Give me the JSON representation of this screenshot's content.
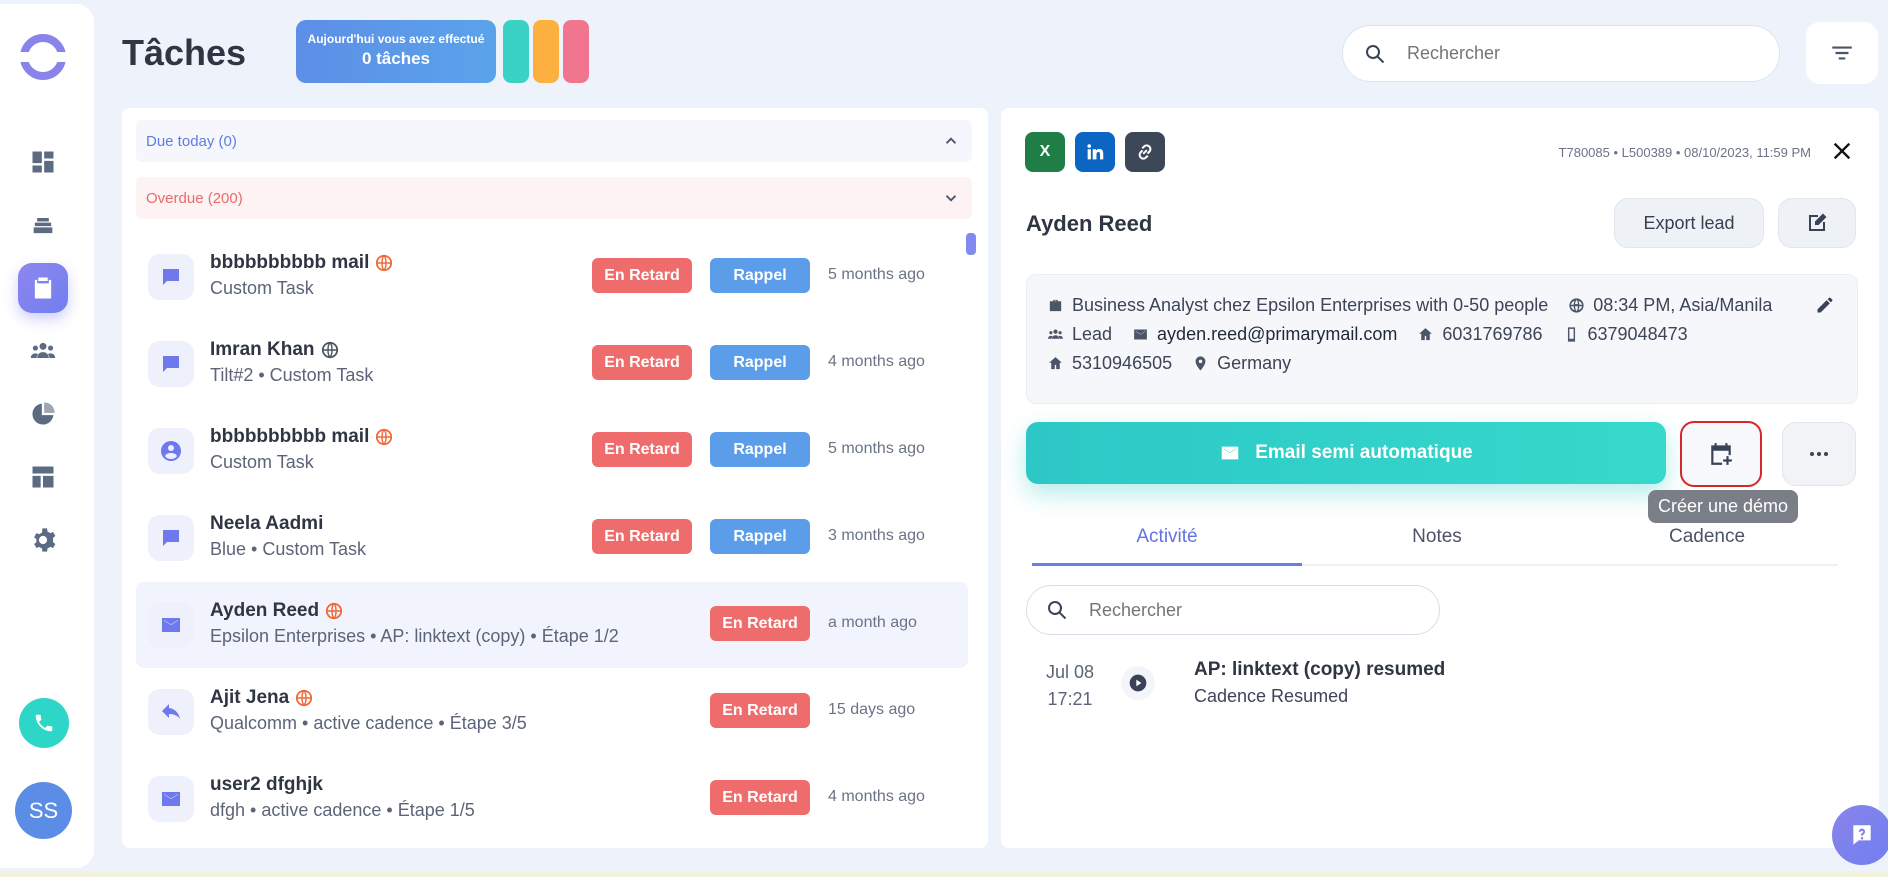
{
  "header": {
    "title": "Tâches",
    "today_label": "Aujourd'hui vous avez effectué",
    "today_count": "0 tâches",
    "pill_colors": [
      "#39d2c5",
      "#fbb040",
      "#f2758f"
    ],
    "search_placeholder": "Rechercher"
  },
  "sidebar": {
    "items": [
      {
        "icon": "dashboard-icon"
      },
      {
        "icon": "stack-icon"
      },
      {
        "icon": "clipboard-icon",
        "active": true
      },
      {
        "icon": "people-icon"
      },
      {
        "icon": "pie-chart-icon"
      },
      {
        "icon": "layout-icon"
      },
      {
        "icon": "gear-icon"
      }
    ],
    "avatar_initials": "SS"
  },
  "tasks": {
    "groups": [
      {
        "label": "Due today (0)",
        "expanded": true
      },
      {
        "label": "Overdue (200)",
        "expanded": false
      }
    ],
    "late_label": "En Retard",
    "remind_label": "Rappel",
    "rows": [
      {
        "name": "bbbbbbbbbb mail",
        "sub": "Custom Task",
        "icon": "message-icon",
        "rappel": true,
        "time": "5 months ago",
        "globe": "orange"
      },
      {
        "name": "Imran Khan",
        "sub": "Tilt#2 • Custom Task",
        "icon": "message-icon",
        "rappel": true,
        "time": "4 months ago",
        "globe": "grey"
      },
      {
        "name": "bbbbbbbbbb mail",
        "sub": "Custom Task",
        "icon": "person-icon",
        "rappel": true,
        "time": "5 months ago",
        "globe": "orange"
      },
      {
        "name": "Neela Aadmi",
        "sub": "Blue • Custom Task",
        "icon": "message-icon",
        "rappel": true,
        "time": "3 months ago",
        "globe": "none"
      },
      {
        "name": "Ayden Reed",
        "sub": "Epsilon Enterprises • AP: linktext (copy) • Étape 1/2",
        "icon": "mail-icon",
        "rappel": false,
        "time": "a month ago",
        "globe": "orange",
        "selected": true
      },
      {
        "name": "Ajit Jena",
        "sub": "Qualcomm • active cadence • Étape 3/5",
        "icon": "reply-icon",
        "rappel": false,
        "time": "15 days ago",
        "globe": "orange"
      },
      {
        "name": "user2 dfghjk",
        "sub": "dfgh • active cadence • Étape 1/5",
        "icon": "mail-icon",
        "rappel": false,
        "time": "4 months ago",
        "globe": "none"
      }
    ]
  },
  "detail": {
    "meta": "T780085 • L500389 • 08/10/2023, 11:59 PM",
    "lead_name": "Ayden Reed",
    "export_label": "Export lead",
    "info": {
      "title": "Business Analyst chez Epsilon Enterprises with 0-50 people",
      "timezone": "08:34 PM, Asia/Manila",
      "type": "Lead",
      "email": "ayden.reed@primarymail.com",
      "phone1": "6031769786",
      "mobile": "6379048473",
      "phone2": "5310946505",
      "country": "Germany"
    },
    "email_button": "Email semi automatique",
    "tooltip": "Créer une démo",
    "tabs": [
      "Activité",
      "Notes",
      "Cadence"
    ],
    "activity_search_placeholder": "Rechercher",
    "activity": {
      "date": "Jul 08",
      "time": "17:21",
      "title": "AP: linktext (copy) resumed",
      "sub": "Cadence Resumed"
    }
  }
}
